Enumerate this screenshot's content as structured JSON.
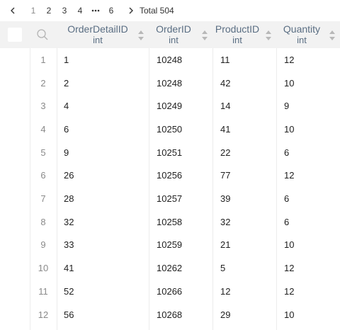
{
  "pager": {
    "prev_icon": "chevron-left-icon",
    "pages": [
      "1",
      "2",
      "3",
      "4",
      "6"
    ],
    "active_page": "1",
    "ellipsis_icon": "ellipsis-icon",
    "next_icon": "chevron-right-icon",
    "total_label": "Total 504"
  },
  "table": {
    "columns": [
      {
        "name": "OrderDetailID",
        "type": "int"
      },
      {
        "name": "OrderID",
        "type": "int"
      },
      {
        "name": "ProductID",
        "type": "int"
      },
      {
        "name": "Quantity",
        "type": "int"
      }
    ],
    "rows": [
      {
        "n": "1",
        "c": [
          "1",
          "10248",
          "11",
          "12"
        ]
      },
      {
        "n": "2",
        "c": [
          "2",
          "10248",
          "42",
          "10"
        ]
      },
      {
        "n": "3",
        "c": [
          "4",
          "10249",
          "14",
          "9"
        ]
      },
      {
        "n": "4",
        "c": [
          "6",
          "10250",
          "41",
          "10"
        ]
      },
      {
        "n": "5",
        "c": [
          "9",
          "10251",
          "22",
          "6"
        ]
      },
      {
        "n": "6",
        "c": [
          "26",
          "10256",
          "77",
          "12"
        ]
      },
      {
        "n": "7",
        "c": [
          "28",
          "10257",
          "39",
          "6"
        ]
      },
      {
        "n": "8",
        "c": [
          "32",
          "10258",
          "32",
          "6"
        ]
      },
      {
        "n": "9",
        "c": [
          "33",
          "10259",
          "21",
          "10"
        ]
      },
      {
        "n": "10",
        "c": [
          "41",
          "10262",
          "5",
          "12"
        ]
      },
      {
        "n": "11",
        "c": [
          "52",
          "10266",
          "12",
          "12"
        ]
      },
      {
        "n": "12",
        "c": [
          "56",
          "10268",
          "29",
          "10"
        ]
      }
    ]
  },
  "icons": {
    "select_all": "checkbox-icon",
    "search": "search-icon",
    "sort": "sort-icon"
  },
  "colors": {
    "header_bg": "#f2f2f2",
    "header_text": "#5a6e83",
    "row_number": "#8a8a8a"
  }
}
